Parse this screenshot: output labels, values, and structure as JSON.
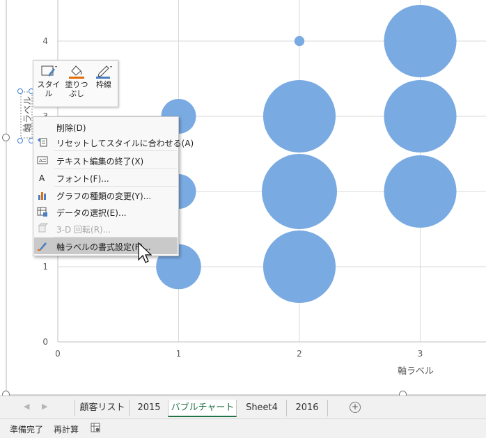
{
  "chart_data": {
    "type": "bubble",
    "x": [
      1,
      1,
      1,
      2,
      2,
      2,
      2,
      3,
      3,
      3
    ],
    "y": [
      1,
      2,
      3,
      1,
      2,
      3,
      4,
      2,
      3,
      4
    ],
    "sizes": [
      1.0,
      0.6,
      0.6,
      2.6,
      2.8,
      2.6,
      0.05,
      2.6,
      2.6,
      2.6
    ],
    "x_ticks": [
      "0",
      "1",
      "2",
      "3"
    ],
    "y_ticks": [
      "0",
      "1",
      "2",
      "3",
      "4"
    ],
    "xlim": [
      0,
      3.5
    ],
    "ylim": [
      0,
      4.3
    ],
    "xlabel": "軸ラベル",
    "ylabel": "軸ラベル",
    "grid": true,
    "bubble_color": "#7aaae2"
  },
  "mini_toolbar": {
    "style_label": "スタイ\nル",
    "fill_label": "塗りつ\nぶし",
    "outline_label": "枠線"
  },
  "context_menu": {
    "items": [
      {
        "label": "削除(D)",
        "icon": "delete-icon",
        "disabled": false
      },
      {
        "label": "リセットしてスタイルに合わせる(A)",
        "icon": "reset-style-icon",
        "disabled": false
      },
      {
        "label": "テキスト編集の終了(X)",
        "icon": "exit-text-edit-icon",
        "disabled": false
      },
      {
        "label": "フォント(F)...",
        "icon": "font-icon",
        "disabled": false
      },
      {
        "label": "グラフの種類の変更(Y)...",
        "icon": "chart-type-icon",
        "disabled": false
      },
      {
        "label": "データの選択(E)...",
        "icon": "select-data-icon",
        "disabled": false
      },
      {
        "label": "3-D 回転(R)...",
        "icon": "3d-rotation-icon",
        "disabled": true
      },
      {
        "label": "軸ラベルの書式設定(F)...",
        "icon": "format-axis-title-icon",
        "disabled": false
      }
    ]
  },
  "sheet_tabs": {
    "tabs": [
      "顧客リスト",
      "2015",
      "バブルチャート",
      "Sheet4",
      "2016"
    ],
    "active": "バブルチャート"
  },
  "status_bar": {
    "ready": "準備完了",
    "recalc": "再計算"
  },
  "colors": {
    "accent": "#217346",
    "bubble": "#7aaae2",
    "menu_highlight": "#c9c9c9"
  }
}
